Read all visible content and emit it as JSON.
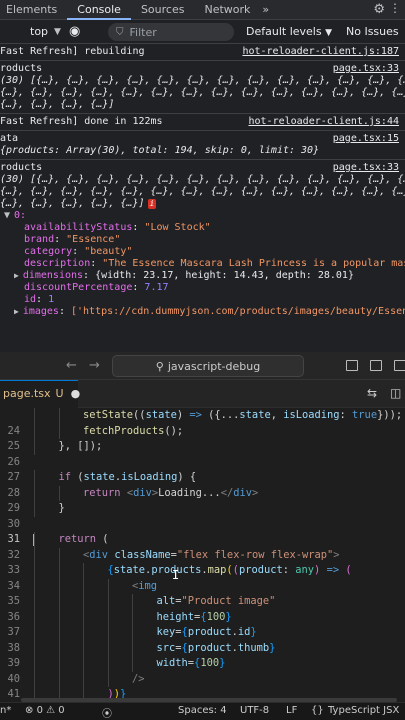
{
  "devtools": {
    "tabs": [
      "Elements",
      "Console",
      "Sources",
      "Network"
    ],
    "more_tabs": "»",
    "toolbar": {
      "context": "top",
      "filter_placeholder": "Filter",
      "levels": "Default levels",
      "issues": "No Issues"
    },
    "messages": {
      "m1": {
        "text": "Fast Refresh] rebuilding",
        "source": "hot-reloader-client.js:187"
      },
      "m2": {
        "label": "roducts",
        "source": "page.tsx:33",
        "lines": [
          "(30) [{…}, {…}, {…}, {…}, {…}, {…}, {…}, {…}, {…}, {…}, {…}, {…}, {…},",
          "{…}, {…}, {…}, {…}, {…}, {…}, {…}, {…}, {…}, {…}, {…}, {…}, {…}, {…},",
          "{…}, {…}, {…}, {…}]"
        ]
      },
      "m3": {
        "text": "Fast Refresh] done in 122ms",
        "source": "hot-reloader-client.js:44"
      },
      "m4": {
        "label": "ata",
        "source": "page.tsx:15",
        "summary": "{products: Array(30), total: 194, skip: 0, limit: 30}"
      },
      "m5": {
        "label": "roducts",
        "source": "page.tsx:33",
        "lines": [
          "(30) [{…}, {…}, {…}, {…}, {…}, {…}, {…}, {…}, {…}, {…}, {…}, {…}, {…},",
          "{…}, {…}, {…}, {…}, {…}, {…}, {…}, {…}, {…}, {…}, {…}, {…}, {…}, {…},",
          "{…}, {…}, {…}, {…}, {…}]"
        ],
        "badge": "i",
        "index": "0:",
        "props": [
          {
            "key": "availabilityStatus",
            "value": "\"Low Stock\""
          },
          {
            "key": "brand",
            "value": "\"Essence\""
          },
          {
            "key": "category",
            "value": "\"beauty\""
          },
          {
            "key": "description",
            "value": "\"The Essence Mascara Lash Princess is a popular mas"
          },
          {
            "key": "dimensions",
            "value": "{width: 23.17, height: 14.43, depth: 28.01}"
          },
          {
            "key": "discountPercentage",
            "value": "7.17"
          },
          {
            "key": "id",
            "value": "1"
          },
          {
            "key": "images",
            "value": "['https://cdn.dummyjson.com/products/images/beauty/Essen"
          }
        ]
      }
    }
  },
  "vscode": {
    "command_center": "javascript-debug",
    "tab": {
      "name": "page.tsx",
      "status": "U"
    },
    "code_lines": [
      {
        "n": "",
        "indent": 2,
        "html": "<span class='f'>setState</span>((<span class='v'>state</span>) <span class='kb'>=&gt;</span> ({...<span class='v'>state</span>, <span class='v'>isLoading</span>: <span class='kb'>true</span>}));"
      },
      {
        "n": "24",
        "indent": 2,
        "html": "<span class='f'>fetchProducts</span>();"
      },
      {
        "n": "25",
        "indent": 1,
        "html": "}, []);"
      },
      {
        "n": "26",
        "indent": 0,
        "html": ""
      },
      {
        "n": "27",
        "indent": 1,
        "html": "<span class='k'>if</span> (<span class='v'>state</span>.<span class='v'>isLoading</span>) {"
      },
      {
        "n": "28",
        "indent": 2,
        "html": "<span class='k'>return</span> <span class='tg'>&lt;</span><span class='kb'>div</span><span class='tg'>&gt;</span>Loading...<span class='tg'>&lt;/</span><span class='kb'>div</span><span class='tg'>&gt;</span>"
      },
      {
        "n": "29",
        "indent": 1,
        "html": "}"
      },
      {
        "n": "30",
        "indent": 0,
        "html": ""
      },
      {
        "n": "31",
        "indent": 1,
        "html": "<span class='k'>return</span> ("
      },
      {
        "n": "32",
        "indent": 2,
        "html": "<span class='tg'>&lt;</span><span class='kb'>div</span> <span class='v'>className</span>=<span class='s'>\"flex flex-row flex-wrap\"</span><span class='tg'>&gt;</span>"
      },
      {
        "n": "33",
        "indent": 3,
        "html": "<span class='pb'>{</span><span class='v'>state</span>.<span class='v'>products</span>.<span class='f'>map</span><span class='p'>(</span><span class='pp'>(</span><span class='v'>product</span>: <span class='t'>any</span><span class='pp'>)</span> <span class='kb'>=&gt;</span> <span class='pp'>(</span>"
      },
      {
        "n": "34",
        "indent": 4,
        "html": "<span class='tg'>&lt;</span><span class='kb'>img</span>"
      },
      {
        "n": "35",
        "indent": 5,
        "html": "<span class='v'>alt</span>=<span class='s'>\"Product image\"</span>"
      },
      {
        "n": "36",
        "indent": 5,
        "html": "<span class='v'>height</span>=<span class='pb'>{</span><span class='n'>100</span><span class='pb'>}</span>"
      },
      {
        "n": "37",
        "indent": 5,
        "html": "<span class='v'>key</span>=<span class='pb'>{</span><span class='v'>product</span>.<span class='v'>id</span><span class='pb'>}</span>"
      },
      {
        "n": "38",
        "indent": 5,
        "html": "<span class='v'>src</span>=<span class='pb'>{</span><span class='v'>product</span>.<span class='v'>thumb</span><span class='pb'>}</span>"
      },
      {
        "n": "39",
        "indent": 5,
        "html": "<span class='v'>width</span>=<span class='pb'>{</span><span class='n'>100</span><span class='pb'>}</span>"
      },
      {
        "n": "40",
        "indent": 4,
        "html": "<span class='tg'>/&gt;</span>"
      },
      {
        "n": "41",
        "indent": 3,
        "html": "<span class='pp'>)</span><span class='p'>)</span><span class='pb'>}</span>"
      }
    ],
    "status": {
      "mode": "n*",
      "errors": "0",
      "warnings": "0",
      "spaces": "Spaces: 4",
      "encoding": "UTF-8",
      "eol": "LF",
      "language": "TypeScript JSX"
    }
  }
}
